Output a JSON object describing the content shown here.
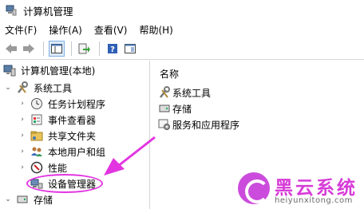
{
  "window": {
    "title": "计算机管理"
  },
  "menu": [
    "文件(F)",
    "操作(A)",
    "查看(V)",
    "帮助(H)"
  ],
  "toolbar": {
    "buttons": [
      "back-icon",
      "forward-icon",
      "show-tree-icon",
      "export-icon",
      "help-icon",
      "console-icon"
    ]
  },
  "tree": {
    "root": "计算机管理(本地)",
    "system_tools": "系统工具",
    "children": [
      "任务计划程序",
      "事件查看器",
      "共享文件夹",
      "本地用户和组",
      "性能",
      "设备管理器"
    ],
    "storage": "存储"
  },
  "list": {
    "header": "名称",
    "items": [
      "系统工具",
      "存储",
      "服务和应用程序"
    ]
  },
  "annotation": {
    "color": "#e234e0"
  },
  "watermark": {
    "title": "黑云系统",
    "url": "heiyunxitong.com"
  }
}
